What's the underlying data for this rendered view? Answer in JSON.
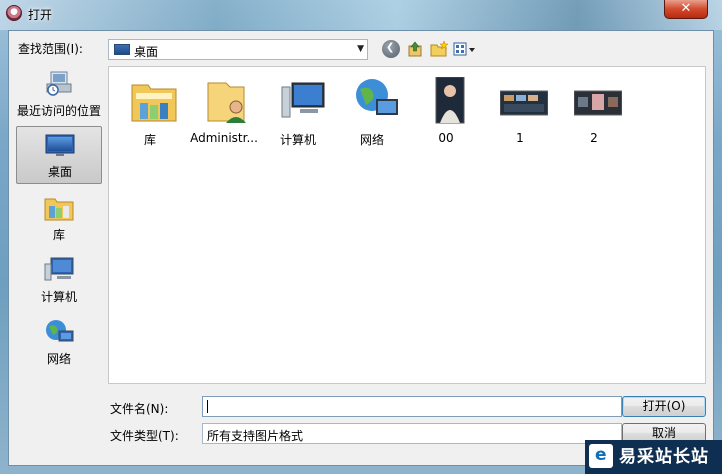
{
  "window": {
    "title": "打开",
    "close_label": "✕"
  },
  "toolbar": {
    "look_in_label": "查找范围(I):",
    "look_in_value": "桌面",
    "icons": [
      "back-icon",
      "up-folder-icon",
      "new-folder-icon",
      "views-menu-icon"
    ]
  },
  "places": [
    {
      "label": "最近访问的位置",
      "icon": "recent-places-icon"
    },
    {
      "label": "桌面",
      "icon": "desktop-icon",
      "selected": true
    },
    {
      "label": "库",
      "icon": "libraries-icon"
    },
    {
      "label": "计算机",
      "icon": "computer-icon"
    },
    {
      "label": "网络",
      "icon": "network-icon"
    }
  ],
  "files": [
    {
      "label": "库",
      "icon": "libraries-folder-icon"
    },
    {
      "label": "Administr...",
      "icon": "user-folder-icon"
    },
    {
      "label": "计算机",
      "icon": "computer-icon"
    },
    {
      "label": "网络",
      "icon": "network-icon"
    },
    {
      "label": "00",
      "icon": "image-thumbnail-icon"
    },
    {
      "label": "1",
      "icon": "image-thumbnail-icon"
    },
    {
      "label": "2",
      "icon": "image-thumbnail-icon"
    }
  ],
  "form": {
    "filename_label": "文件名(N):",
    "filename_value": "",
    "filetype_label": "文件类型(T):",
    "filetype_value": "所有支持图片格式",
    "open_label": "打开(O)",
    "cancel_label": "取消"
  },
  "watermark": {
    "text": "易采站长站"
  }
}
